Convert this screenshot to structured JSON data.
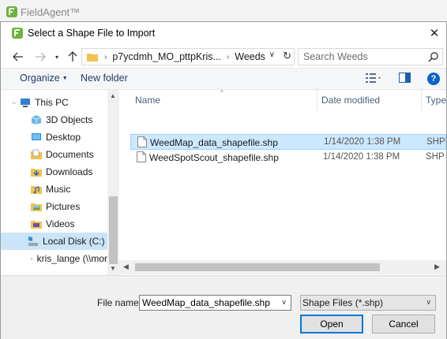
{
  "app": {
    "title": "FieldAgent™"
  },
  "dialog": {
    "title": "Select a Shape File to Import",
    "close_label": "✕"
  },
  "address": {
    "crumbs": [
      "p7ycdmh_MO_pttpKris...",
      "Weeds"
    ],
    "search_placeholder": "Search Weeds"
  },
  "toolbar": {
    "organize_label": "Organize",
    "new_folder_label": "New folder",
    "help_label": "?"
  },
  "nav": {
    "items": [
      {
        "label": "This PC",
        "icon": "pc-icon"
      },
      {
        "label": "3D Objects",
        "icon": "3d-objects-icon"
      },
      {
        "label": "Desktop",
        "icon": "desktop-icon"
      },
      {
        "label": "Documents",
        "icon": "documents-icon"
      },
      {
        "label": "Downloads",
        "icon": "downloads-icon"
      },
      {
        "label": "Music",
        "icon": "music-icon"
      },
      {
        "label": "Pictures",
        "icon": "pictures-icon"
      },
      {
        "label": "Videos",
        "icon": "videos-icon"
      },
      {
        "label": "Local Disk (C:)",
        "icon": "drive-icon",
        "selected": true
      },
      {
        "label": "kris_lange (\\\\mor",
        "icon": "network-drive-icon"
      }
    ]
  },
  "files": {
    "columns": {
      "name": "Name",
      "date": "Date modified",
      "type": "Type"
    },
    "rows": [
      {
        "name": "WeedMap_data_shapefile.shp",
        "date": "1/14/2020 1:38 PM",
        "type": "SHP F",
        "selected": true
      },
      {
        "name": "WeedSpotScout_shapefile.shp",
        "date": "1/14/2020 1:38 PM",
        "type": "SHP F",
        "selected": false
      }
    ]
  },
  "bottom": {
    "file_name_label": "File name:",
    "file_name_value": "WeedMap_data_shapefile.shp",
    "file_type_value": "Shape Files (*.shp)",
    "open_label": "Open",
    "cancel_label": "Cancel"
  },
  "colors": {
    "accent": "#0078d7",
    "selection": "#cce8ff",
    "nav_selection": "#cce4f7",
    "brand_green": "#6db33f"
  }
}
